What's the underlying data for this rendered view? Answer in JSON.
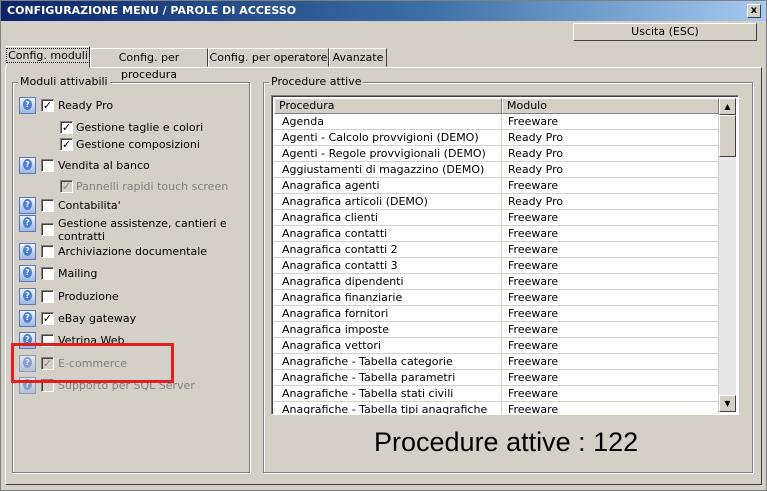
{
  "window": {
    "title": "CONFIGURAZIONE MENU / PAROLE DI ACCESSO",
    "close": "x"
  },
  "header": {
    "exit_label": "Uscita (ESC)"
  },
  "tabs": [
    {
      "label": "Config. moduli"
    },
    {
      "label": "Config. per procedura"
    },
    {
      "label": "Config. per operatore"
    },
    {
      "label": "Avanzate"
    }
  ],
  "modules": {
    "title": "Moduli attivabili",
    "items": [
      {
        "label": "Ready Pro",
        "checked": true
      },
      {
        "label": "Gestione taglie e colori",
        "checked": true
      },
      {
        "label": "Gestione composizioni",
        "checked": true
      },
      {
        "label": "Vendita al banco",
        "checked": false
      },
      {
        "label": "Pannelli rapidi touch screen",
        "checked": true
      },
      {
        "label": "Contabilita'",
        "checked": false
      },
      {
        "label": "Gestione assistenze, cantieri e",
        "checked": false
      },
      {
        "label": "contratti"
      },
      {
        "label": "Archiviazione documentale",
        "checked": false
      },
      {
        "label": "Mailing",
        "checked": false
      },
      {
        "label": "Produzione",
        "checked": false
      },
      {
        "label": "eBay gateway",
        "checked": true
      },
      {
        "label": "Vetrina Web",
        "checked": false
      },
      {
        "label": "E-commerce",
        "checked": true
      },
      {
        "label": "Supporto per SQL Server",
        "checked": false
      }
    ]
  },
  "procedures": {
    "title": "Procedure attive",
    "columns": [
      "Procedura",
      "Modulo"
    ],
    "rows": [
      [
        "Agenda",
        "Freeware"
      ],
      [
        "Agenti - Calcolo provvigioni (DEMO)",
        "Ready Pro"
      ],
      [
        "Agenti - Regole provvigionali (DEMO)",
        "Ready Pro"
      ],
      [
        "Aggiustamenti di magazzino (DEMO)",
        "Ready Pro"
      ],
      [
        "Anagrafica agenti",
        "Freeware"
      ],
      [
        "Anagrafica articoli (DEMO)",
        "Ready Pro"
      ],
      [
        "Anagrafica clienti",
        "Freeware"
      ],
      [
        "Anagrafica contatti",
        "Freeware"
      ],
      [
        "Anagrafica contatti 2",
        "Freeware"
      ],
      [
        "Anagrafica contatti 3",
        "Freeware"
      ],
      [
        "Anagrafica dipendenti",
        "Freeware"
      ],
      [
        "Anagrafica finanziarie",
        "Freeware"
      ],
      [
        "Anagrafica fornitori",
        "Freeware"
      ],
      [
        "Anagrafica imposte",
        "Freeware"
      ],
      [
        "Anagrafica vettori",
        "Freeware"
      ],
      [
        "Anagrafiche - Tabella categorie",
        "Freeware"
      ],
      [
        "Anagrafiche - Tabella parametri",
        "Freeware"
      ],
      [
        "Anagrafiche - Tabella stati civili",
        "Freeware"
      ],
      [
        "Anagrafiche - Tabella tipi anagrafiche",
        "Freeware"
      ]
    ],
    "count_label": "Procedure attive : 122"
  }
}
